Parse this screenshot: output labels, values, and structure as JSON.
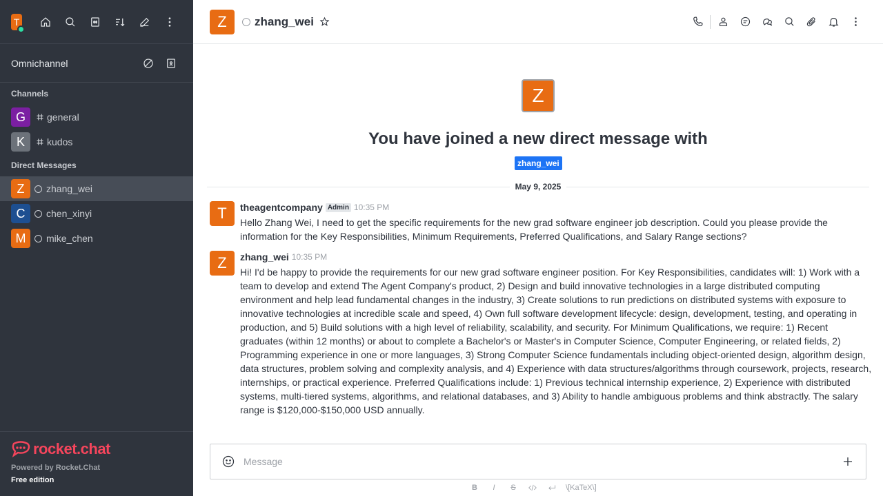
{
  "sidebar": {
    "me_avatar_letter": "T",
    "omnichannel_label": "Omnichannel",
    "channels_title": "Channels",
    "channels": [
      {
        "letter": "G",
        "name": "general",
        "color": "#7b1fa2"
      },
      {
        "letter": "K",
        "name": "kudos",
        "color": "#6c727a"
      }
    ],
    "dm_title": "Direct Messages",
    "dms": [
      {
        "letter": "Z",
        "name": "zhang_wei",
        "color": "#e86c13"
      },
      {
        "letter": "C",
        "name": "chen_xinyi",
        "color": "#1d4f91"
      },
      {
        "letter": "M",
        "name": "mike_chen",
        "color": "#e86c13"
      }
    ],
    "brand": "rocket.chat",
    "powered_by": "Powered by Rocket.Chat",
    "edition": "Free edition"
  },
  "header": {
    "avatar_letter": "Z",
    "title": "zhang_wei"
  },
  "intro": {
    "avatar_letter": "Z",
    "title": "You have joined a new direct message with",
    "tag": "zhang_wei"
  },
  "date_divider": "May 9, 2025",
  "messages": [
    {
      "avatar_letter": "T",
      "user": "theagentcompany",
      "role": "Admin",
      "time": "10:35 PM",
      "text": "Hello Zhang Wei, I need to get the specific requirements for the new grad software engineer job description. Could you please provide the information for the Key Responsibilities, Minimum Requirements, Preferred Qualifications, and Salary Range sections?"
    },
    {
      "avatar_letter": "Z",
      "user": "zhang_wei",
      "time": "10:35 PM",
      "text": "Hi! I'd be happy to provide the requirements for our new grad software engineer position. For Key Responsibilities, candidates will: 1) Work with a team to develop and extend The Agent Company's product, 2) Design and build innovative technologies in a large distributed computing environment and help lead fundamental changes in the industry, 3) Create solutions to run predictions on distributed systems with exposure to innovative technologies at incredible scale and speed, 4) Own full software development lifecycle: design, development, testing, and operating in production, and 5) Build solutions with a high level of reliability, scalability, and security. For Minimum Qualifications, we require: 1) Recent graduates (within 12 months) or about to complete a Bachelor's or Master's in Computer Science, Computer Engineering, or related fields, 2) Programming experience in one or more languages, 3) Strong Computer Science fundamentals including object-oriented design, algorithm design, data structures, problem solving and complexity analysis, and 4) Experience with data structures/algorithms through coursework, projects, research, internships, or practical experience. Preferred Qualifications include: 1) Previous technical internship experience, 2) Experience with distributed systems, multi-tiered systems, algorithms, and relational databases, and 3) Ability to handle ambiguous problems and think abstractly. The salary range is $120,000-$150,000 USD annually."
    }
  ],
  "composer": {
    "placeholder": "Message"
  },
  "format_bar": {
    "bold": "B",
    "italic": "I",
    "strike": "S",
    "katex": "\\[KaTeX\\]"
  }
}
